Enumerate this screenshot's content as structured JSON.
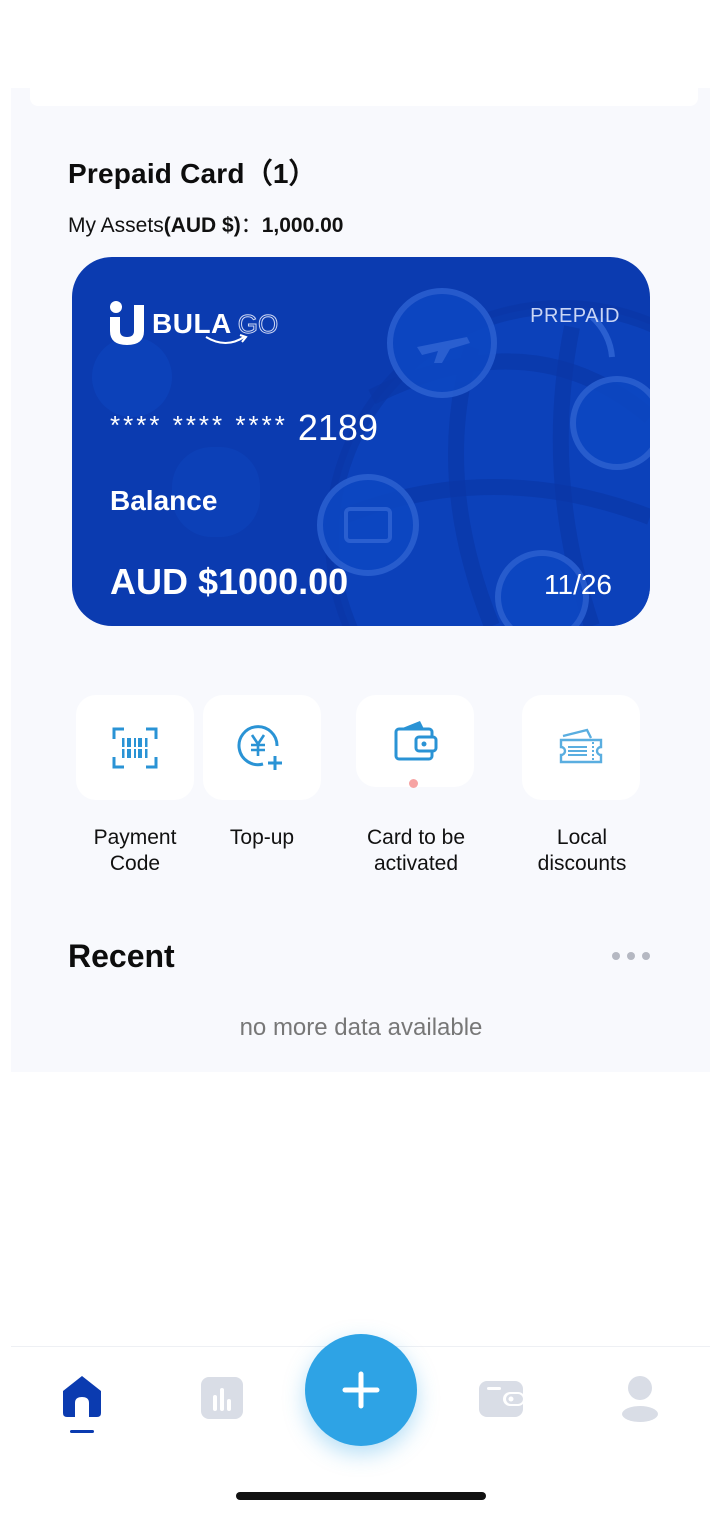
{
  "prepaid": {
    "title": "Prepaid Card（1）",
    "assets_prefix": "My Assets",
    "assets_currency": "(AUD $)",
    "assets_sep": "：",
    "assets_value": "1,000.00"
  },
  "card": {
    "brand_bold": "BULA",
    "brand_light": "GO",
    "type": "PREPAID",
    "masked": "**** **** ****",
    "last4": "2189",
    "balance_label": "Balance",
    "balance_value": "AUD $1000.00",
    "expiry": "11/26",
    "color": "#0b3bb0"
  },
  "actions": [
    {
      "label_1": "Payment",
      "label_2": "Code",
      "icon": "barcode-scan-icon"
    },
    {
      "label_1": "Top-up",
      "label_2": "",
      "icon": "yen-plus-icon"
    },
    {
      "label_1": "Card to be",
      "label_2": "activated",
      "icon": "wallet-icon"
    },
    {
      "label_1": "Local",
      "label_2": "discounts",
      "icon": "ticket-icon"
    }
  ],
  "recent": {
    "title": "Recent",
    "empty_text": "no more data available"
  },
  "tabs": [
    {
      "name": "home",
      "icon": "home-icon",
      "active": true
    },
    {
      "name": "stats",
      "icon": "bar-chart-icon",
      "active": false
    },
    {
      "name": "add",
      "icon": "plus-icon",
      "active": false
    },
    {
      "name": "wallet",
      "icon": "wallet-icon",
      "active": false
    },
    {
      "name": "profile",
      "icon": "user-icon",
      "active": false
    }
  ],
  "colors": {
    "accent": "#2ea3e5",
    "brand_dark": "#0b3bb0",
    "icon_blue": "#2a93d5",
    "inactive_tab": "#d9dde6"
  }
}
